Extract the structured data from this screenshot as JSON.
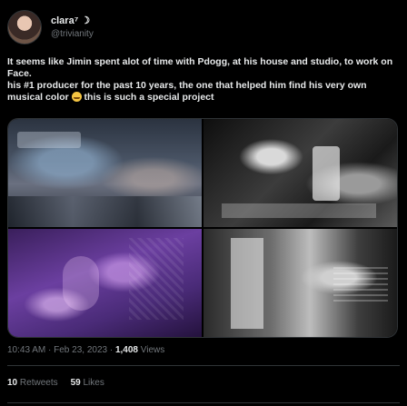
{
  "author": {
    "display_name": "clara⁷ ☽",
    "handle": "@trivianity"
  },
  "tweet": {
    "line1": "It seems like Jimin spent alot of time with Pdogg, at his house and studio, to work on Face.",
    "line2_before": "his #1 producer for the past 10 years, the one that helped him find his very own musical color",
    "line2_after": "this is such a special project"
  },
  "media": {
    "count": 4
  },
  "meta": {
    "time_date": "10:43 AM · Feb 23, 2023 · ",
    "views_count": "1,408",
    "views_label": "Views"
  },
  "stats": {
    "retweets_count": "10",
    "retweets_label": "Retweets",
    "likes_count": "59",
    "likes_label": "Likes"
  }
}
